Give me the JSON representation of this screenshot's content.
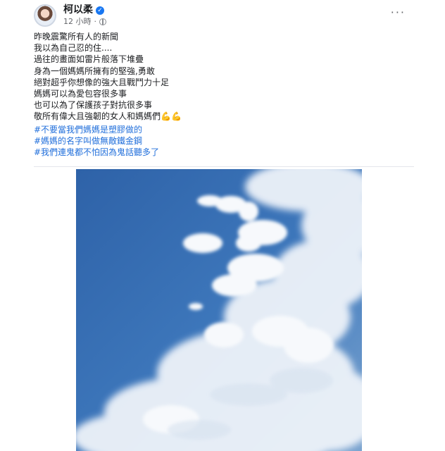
{
  "header": {
    "name": "柯以柔",
    "time": "12 小時",
    "separator": "·",
    "verified_icon": "verified-badge-icon",
    "privacy_icon": "globe-icon",
    "menu_icon": "more-options-icon",
    "menu_label": "···"
  },
  "post": {
    "lines": [
      "昨晚震驚所有人的新聞",
      "我以為自己忍的住....",
      "過往的畫面如雷片般落下堆疊",
      "身為一個媽媽所擁有的堅強,勇敢",
      "絕對超乎你想像的強大且戰鬥力十足",
      "媽媽可以為愛包容很多事",
      "也可以為了保護孩子對抗很多事",
      "敬所有偉大且強韌的女人和媽媽們💪💪"
    ],
    "hashtags": [
      "#不要當我們媽媽是塑膠做的",
      "#媽媽的名字叫做無敵鐵金鋼",
      "#我們連鬼都不怕因為鬼話聽多了"
    ]
  },
  "photo": {
    "subject": "blue sky with white clouds",
    "colors": {
      "sky_top": "#2e62a8",
      "sky_bottom": "#6d98c8",
      "cloud": "#f4f6f8"
    }
  },
  "colors": {
    "text": "#1c1e21",
    "muted": "#65676b",
    "link": "#216fdb",
    "verified": "#1877f2"
  }
}
